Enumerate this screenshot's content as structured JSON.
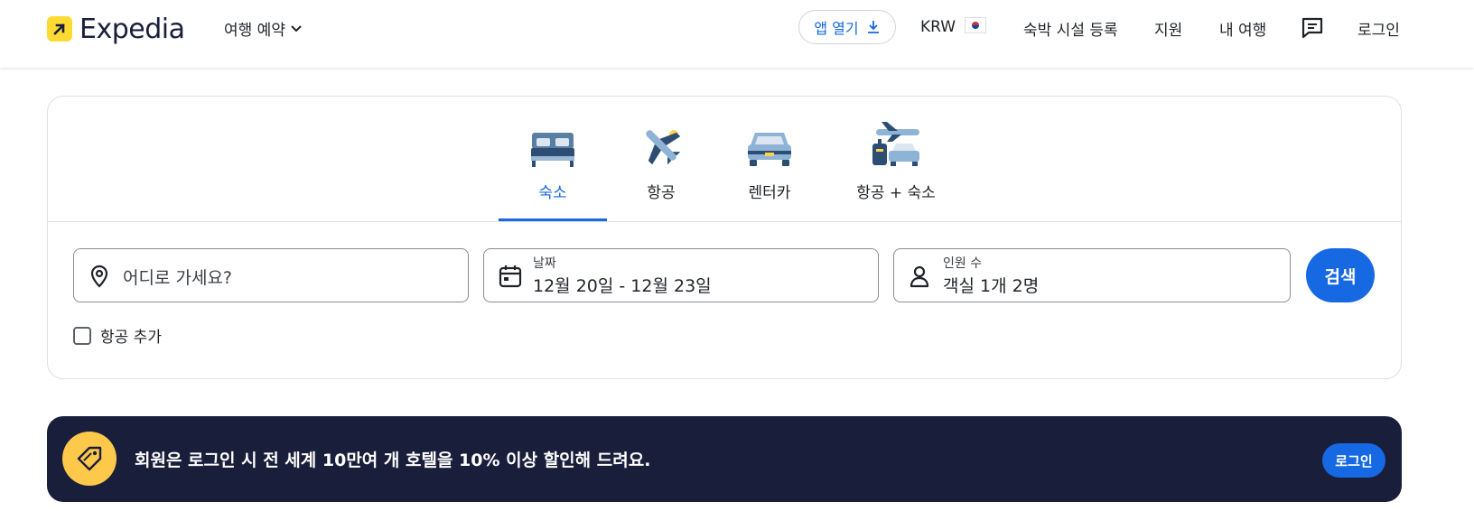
{
  "header": {
    "logo_text": "Expedia",
    "trip_menu": "여행 예약",
    "app_button": "앱 열기",
    "currency": "KRW",
    "list_property": "숙박 시설 등록",
    "support": "지원",
    "my_trips": "내 여행",
    "sign_in": "로그인"
  },
  "tabs": [
    {
      "label": "숙소",
      "icon": "bed-icon",
      "active": true
    },
    {
      "label": "항공",
      "icon": "airplane-icon",
      "active": false
    },
    {
      "label": "렌터카",
      "icon": "car-icon",
      "active": false
    },
    {
      "label": "항공 + 숙소",
      "icon": "plane-luggage-icon",
      "active": false
    }
  ],
  "search": {
    "destination_placeholder": "어디로 가세요?",
    "date_label": "날짜",
    "date_value": "12월 20일 - 12월 23일",
    "travelers_label": "인원 수",
    "travelers_value": "객실 1개 2명",
    "search_button": "검색",
    "add_flight": "항공 추가"
  },
  "banner": {
    "text": "회원은 로그인 시 전 세계 10만여 개 호텔을 10% 이상 할인해 드려요.",
    "button": "로그인"
  },
  "colors": {
    "accent": "#1668e3",
    "banner_bg": "#191e3b",
    "logo_yellow": "#fddb32",
    "banner_icon": "#fec84b"
  }
}
